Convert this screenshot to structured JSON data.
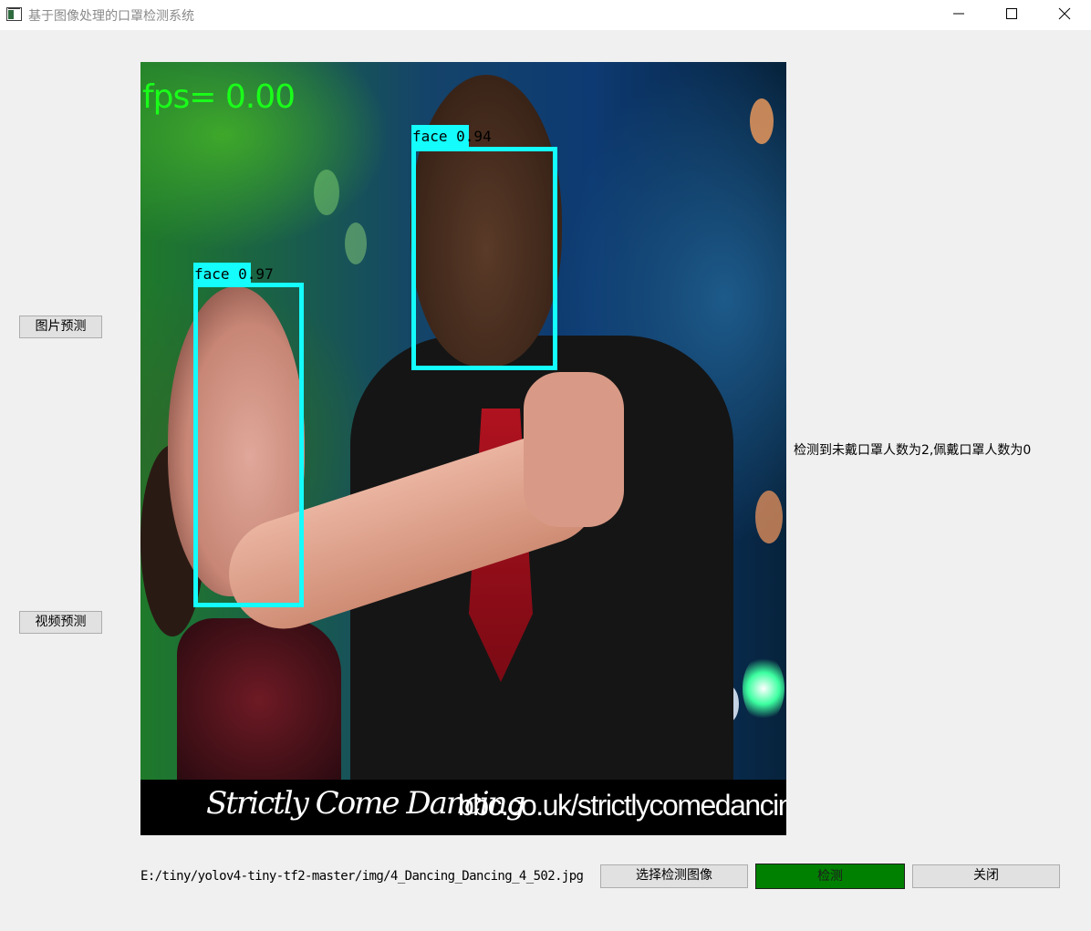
{
  "window": {
    "title": "基于图像处理的口罩检测系统"
  },
  "sidebar": {
    "image_predict_label": "图片预测",
    "video_predict_label": "视频预测"
  },
  "canvas": {
    "fps_text": "fps= 0.00",
    "detections": [
      {
        "label": "face 0.94",
        "color": "#14fcfc"
      },
      {
        "label": "face 0.97",
        "color": "#14fcfc"
      }
    ],
    "banner_logo": "Strictly Come Dancing",
    "banner_url": "bbc.co.uk/strictlycomedancing"
  },
  "result": {
    "text": "检测到未戴口罩人数为2,佩戴口罩人数为0"
  },
  "footer": {
    "file_path": "E:/tiny/yolov4-tiny-tf2-master/img/4_Dancing_Dancing_4_502.jpg",
    "select_label": "选择检测图像",
    "detect_label": "检测",
    "close_label": "关闭"
  },
  "colors": {
    "detect_button": "#008000",
    "detection_box": "#14fcfc",
    "fps_text": "#1aff1a"
  }
}
